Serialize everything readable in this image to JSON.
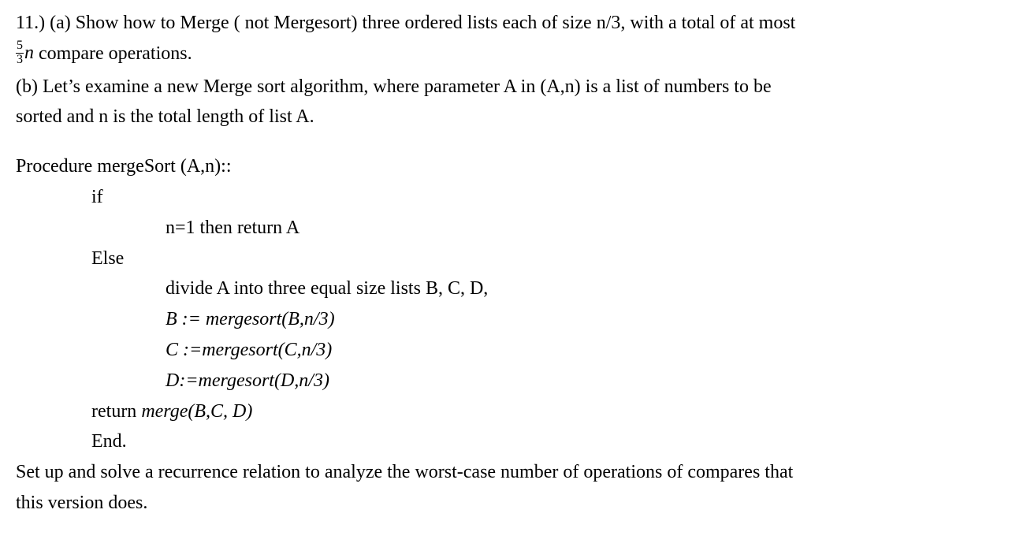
{
  "problem": {
    "number": "11.)",
    "partA": {
      "label": "(a)",
      "line1_before_fraction": "Show how to Merge ( not Mergesort) three ordered lists each of size n/3, with a total of at most",
      "fraction_num": "5",
      "fraction_den": "3",
      "fraction_var": "n",
      "line2_after_fraction": "compare operations."
    },
    "partB": {
      "label": "(b)",
      "line1": "Let’s examine a new  Merge sort algorithm, where parameter A in (A,n) is a list of numbers to be",
      "line2": "sorted and n is the total length of list A."
    },
    "procedure": {
      "header": "Procedure mergeSort (A,n)::",
      "if_kw": "if",
      "if_cond": "n=1 then return A",
      "else_kw": "Else",
      "step_divide": "divide A into three equal size lists B, C, D,",
      "assign_B": "B := mergesort(B,n/3)",
      "assign_C": "C :=mergesort(C,n/3)",
      "assign_D": "D:=mergesort(D,n/3)",
      "return_prefix": "return  ",
      "return_call": "merge(B,C, D)",
      "end_kw": "End."
    },
    "closing": {
      "line1": " Set up and solve a recurrence relation to analyze the worst-case number of operations of compares that",
      "line2": "this version does."
    }
  }
}
